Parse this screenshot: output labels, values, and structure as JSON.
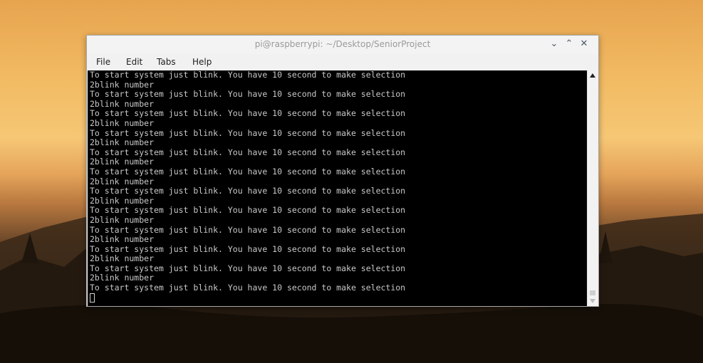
{
  "window": {
    "title": "pi@raspberrypi: ~/Desktop/SeniorProject",
    "controls": [
      "minimize-icon",
      "maximize-icon",
      "close-icon"
    ]
  },
  "menu": {
    "items": [
      "File",
      "Edit",
      "Tabs",
      "Help"
    ]
  },
  "terminal": {
    "lines": [
      "To start system just blink. You have 10 second to make selection",
      "2blink number",
      "To start system just blink. You have 10 second to make selection",
      "2blink number",
      "To start system just blink. You have 10 second to make selection",
      "2blink number",
      "To start system just blink. You have 10 second to make selection",
      "2blink number",
      "To start system just blink. You have 10 second to make selection",
      "2blink number",
      "To start system just blink. You have 10 second to make selection",
      "2blink number",
      "To start system just blink. You have 10 second to make selection",
      "2blink number",
      "To start system just blink. You have 10 second to make selection",
      "2blink number",
      "To start system just blink. You have 10 second to make selection",
      "2blink number",
      "To start system just blink. You have 10 second to make selection",
      "2blink number",
      "To start system just blink. You have 10 second to make selection",
      "2blink number",
      "To start system just blink. You have 10 second to make selection"
    ]
  }
}
